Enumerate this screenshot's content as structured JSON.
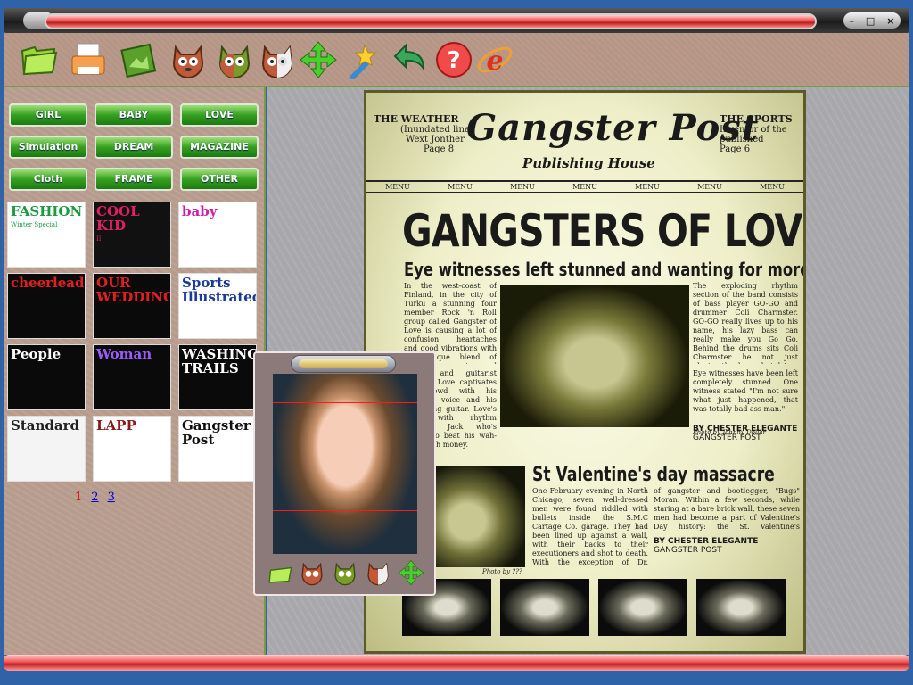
{
  "window": {
    "buttons": [
      "–",
      "□",
      "×"
    ]
  },
  "toolbar": {
    "tools": [
      {
        "name": "open-folder-icon"
      },
      {
        "name": "print-icon"
      },
      {
        "name": "save-image-icon"
      },
      {
        "name": "face-icon-1"
      },
      {
        "name": "face-icon-2"
      },
      {
        "name": "face-icon-3"
      },
      {
        "name": "move-arrows-icon"
      },
      {
        "name": "wand-icon"
      },
      {
        "name": "undo-icon"
      },
      {
        "name": "help-icon"
      },
      {
        "name": "internet-explorer-icon"
      }
    ]
  },
  "categories": [
    "GIRL",
    "BABY",
    "LOVE",
    "Simulation",
    "DREAM",
    "MAGAZINE",
    "Cloth",
    "FRAME",
    "OTHER"
  ],
  "thumbnails": [
    {
      "title": "FASHION",
      "sub": "Winter Special",
      "bg": "#ffffff",
      "fg": "#1a9a40"
    },
    {
      "title": "COOL KID",
      "sub": "II",
      "bg": "#111111",
      "fg": "#e02060"
    },
    {
      "title": "baby",
      "sub": "",
      "bg": "#ffffff",
      "fg": "#d21aa8"
    },
    {
      "title": "cheerleader",
      "sub": "",
      "bg": "#0a0a0a",
      "fg": "#e02020"
    },
    {
      "title": "OUR WEDDING",
      "sub": "",
      "bg": "#0a0a0a",
      "fg": "#e02020"
    },
    {
      "title": "Sports Illustrated",
      "sub": "",
      "bg": "#ffffff",
      "fg": "#1a3a9a"
    },
    {
      "title": "People",
      "sub": "",
      "bg": "#0a0a0a",
      "fg": "#ffffff"
    },
    {
      "title": "Woman",
      "sub": "",
      "bg": "#0a0a0a",
      "fg": "#9b5cff"
    },
    {
      "title": "WASHINGTON TRAILS",
      "sub": "",
      "bg": "#0a0a0a",
      "fg": "#ffffff"
    },
    {
      "title": "Standard",
      "sub": "",
      "bg": "#f4f4f4",
      "fg": "#222222"
    },
    {
      "title": "LAPP",
      "sub": "",
      "bg": "#ffffff",
      "fg": "#8a1a1a"
    },
    {
      "title": "Gangster Post",
      "sub": "",
      "bg": "#ffffff",
      "fg": "#111111"
    }
  ],
  "pager": {
    "pages": [
      "1",
      "2",
      "3"
    ],
    "current": "1"
  },
  "newspaper": {
    "left_box": {
      "title": "THE WEATHER",
      "line1": "(Inundated line)",
      "line2": "Wext Jonther",
      "line3": "Page 8"
    },
    "right_box": {
      "title": "THE SPORTS",
      "line1": "Inventor of the",
      "line2": "published",
      "line3": "Page 6"
    },
    "masthead": "Gangster Post",
    "publisher": "Publishing House",
    "menu": [
      "MENU",
      "MENU",
      "MENU",
      "MENU",
      "MENU",
      "MENU",
      "MENU"
    ],
    "headline": "GANGSTERS OF LOVE?",
    "subheadline": "Eye witnesses left stunned and wanting for more",
    "col_left": "In the west-coast of Finland, in the city of Turku a stunning four member Rock 'n Roll group called Gangster of Love is causing a lot of confusion, heartaches and good vibrations with the unique blend of rockabilly, country and kick ass soul.",
    "col_left2": "Singer and guitarist Michael Love captivates his crowd with his catching voice and his screaming guitar. Love's back with rhythm guitarist Jack who's known to beat his wah-wahs with money.",
    "col_right": "The exploding rhythm section of the band consists of bass player GO-GO and drummer Coli Charmster. GO-GO really lives up to his name, his lazy bass can really make you Go Go. Behind the drums sits Coli Charmster he not just playing the drums but drives them to hell and back.",
    "col_right2": "Eye witnesses have been left completely stunned. One witness stated \"I'm not sure what just happened, that was totally bad ass man.\"",
    "photo_credit": "Photo by Johnny Dollar",
    "byline1": "BY CHESTER ELEGANTE",
    "byline1b": "GANGSTER POST",
    "headline2": "St Valentine's day massacre",
    "col3": "One February evening in North Chicago, seven well-dressed men were found riddled with bullets inside the S.M.C Cartage Co. garage. They had been lined up against a wall, with their backs to their executioners and shot to death. With the exception of Dr. Reinhardt H. Schwimmer these men were mobsters working under the leadership",
    "col4": "of gangster and bootlegger, \"Bugs\" Moran. Within a few seconds, while staring at a bare brick wall, these seven men had become a part of Valentine's Day history: the St. Valentine's Massacre.",
    "photo_credit2": "Photo by ???",
    "byline2": "BY CHESTER ELEGANTE",
    "byline2b": "GANGSTER POST"
  },
  "photopanel": {
    "tools": [
      {
        "name": "open-folder-icon"
      },
      {
        "name": "face-icon-1"
      },
      {
        "name": "face-icon-2"
      },
      {
        "name": "face-icon-3"
      },
      {
        "name": "move-arrows-icon"
      }
    ]
  }
}
